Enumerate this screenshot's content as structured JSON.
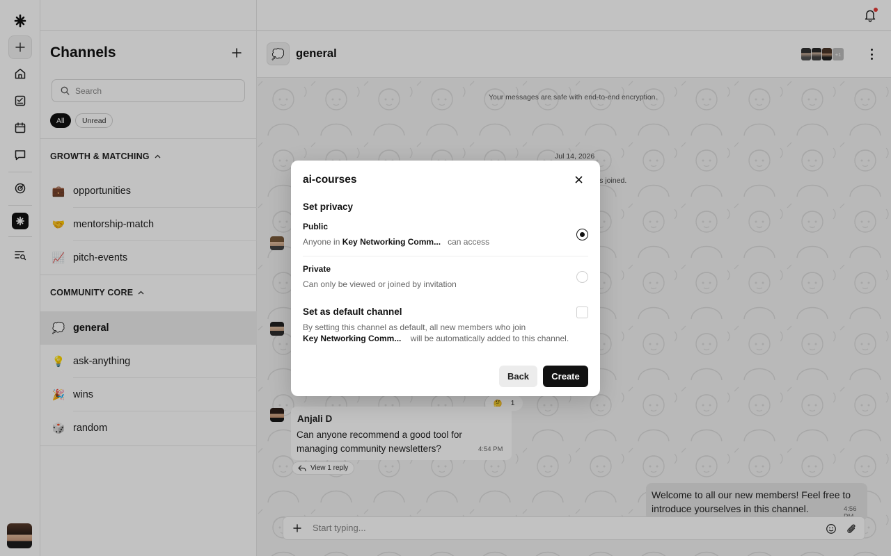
{
  "rail": {
    "items": [
      "logo-icon",
      "plus-icon",
      "home-icon",
      "tasks-icon",
      "calendar-icon",
      "chat-icon",
      "analytics-icon",
      "brand-icon",
      "search-list-icon"
    ]
  },
  "sidebar": {
    "title": "Channels",
    "search_placeholder": "Search",
    "filters": {
      "all": "All",
      "unread": "Unread"
    },
    "sections": [
      {
        "label": "GROWTH & MATCHING",
        "channels": [
          {
            "icon": "💼",
            "name": "opportunities"
          },
          {
            "icon": "🤝",
            "name": "mentorship-match"
          },
          {
            "icon": "📈",
            "name": "pitch-events"
          }
        ]
      },
      {
        "label": "COMMUNITY CORE",
        "channels": [
          {
            "icon": "💭",
            "name": "general"
          },
          {
            "icon": "💡",
            "name": "ask-anything"
          },
          {
            "icon": "🎉",
            "name": "wins"
          },
          {
            "icon": "🎲",
            "name": "random"
          }
        ]
      }
    ]
  },
  "header": {
    "channel_name": "general",
    "channel_icon": "💭",
    "more_members": "+1"
  },
  "chat": {
    "encryption_note": "Your messages are safe with end-to-end encryption.",
    "date": "Jul 14, 2026",
    "joined_note": "ners joined.",
    "reaction": {
      "emoji": "🤔",
      "count": "1"
    },
    "message": {
      "author": "Anjali D",
      "text": "Can anyone recommend a good tool for managing community newsletters?",
      "time": "4:54 PM",
      "reply_label": "View 1 reply"
    },
    "outgoing": {
      "text": "Welcome to all our new members! Feel free to introduce yourselves in this channel.",
      "time": "4:56 PM"
    },
    "composer_placeholder": "Start typing..."
  },
  "modal": {
    "title": "ai-courses",
    "privacy_heading": "Set privacy",
    "public": {
      "title": "Public",
      "desc_prefix": "Anyone in",
      "community": "Key Networking Comm...",
      "desc_suffix": "can access",
      "selected": true
    },
    "private": {
      "title": "Private",
      "desc": "Can only be viewed or joined by invitation",
      "selected": false
    },
    "default_channel": {
      "title": "Set as default channel",
      "desc_line1": "By setting this channel as default, all new members who join",
      "community": "Key Networking Comm...",
      "desc_suffix": "will be automatically added to this channel.",
      "checked": false
    },
    "back_label": "Back",
    "create_label": "Create"
  }
}
